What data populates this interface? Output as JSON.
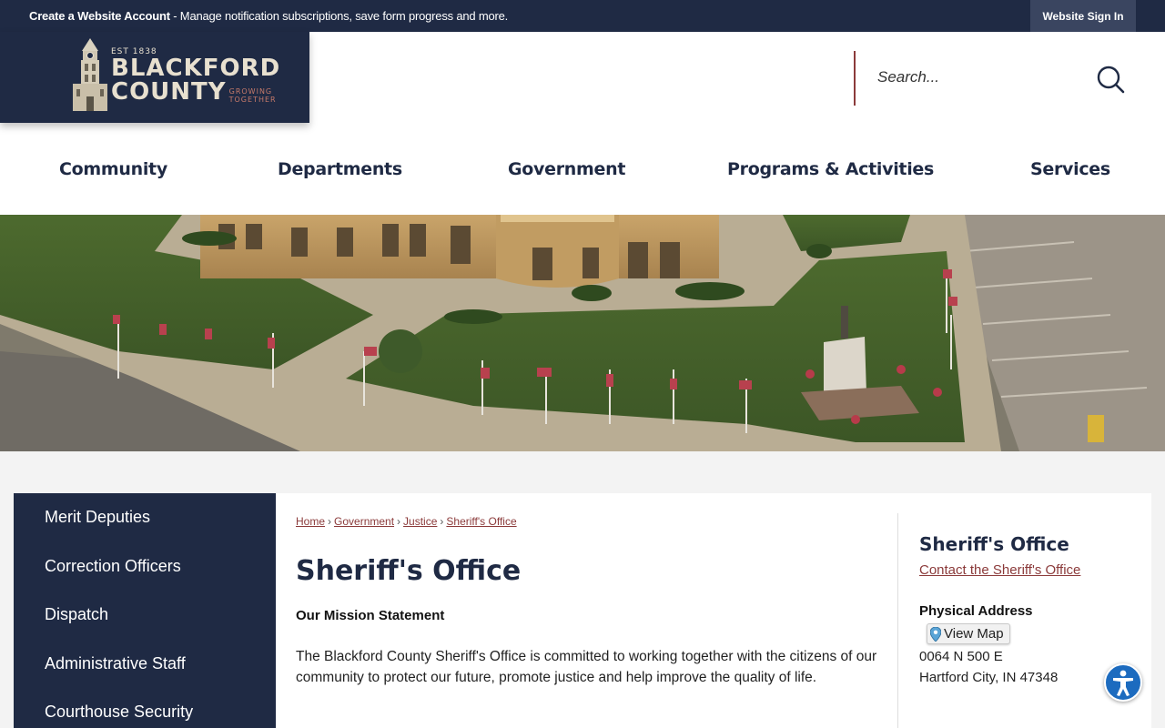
{
  "topbar": {
    "create_account": "Create a Website Account",
    "message": " - Manage notification subscriptions, save form progress and more.",
    "sign_in": "Website Sign In"
  },
  "logo": {
    "est": "EST 1838",
    "line1": "BLACKFORD",
    "line2": "COUNTY",
    "tagline1": "GROWING",
    "tagline2": "TOGETHER"
  },
  "search": {
    "placeholder": "Search..."
  },
  "nav": {
    "items": [
      "Community",
      "Departments",
      "Government",
      "Programs & Activities",
      "Services"
    ]
  },
  "sidebar": {
    "items": [
      "Merit Deputies",
      "Correction Officers",
      "Dispatch",
      "Administrative Staff",
      "Courthouse Security"
    ]
  },
  "breadcrumb": {
    "items": [
      "Home",
      "Government",
      "Justice",
      "Sheriff's Office"
    ],
    "separator": "›"
  },
  "main": {
    "title": "Sheriff's Office",
    "mission_heading": "Our Mission Statement",
    "mission_text": "The Blackford County Sheriff's Office is committed to working together with the citizens of our community to protect our future, promote justice and help improve the quality of life."
  },
  "contact": {
    "title": "Sheriff's Office",
    "link": "Contact the Sheriff's Office",
    "address_label": "Physical Address",
    "view_map": "View Map",
    "address_line1": "0064 N 500 E",
    "address_line2": "Hartford City, IN 47348"
  },
  "colors": {
    "navy": "#1f2a44",
    "accent": "#8b3a3a",
    "accessibility": "#1c6bbf"
  }
}
